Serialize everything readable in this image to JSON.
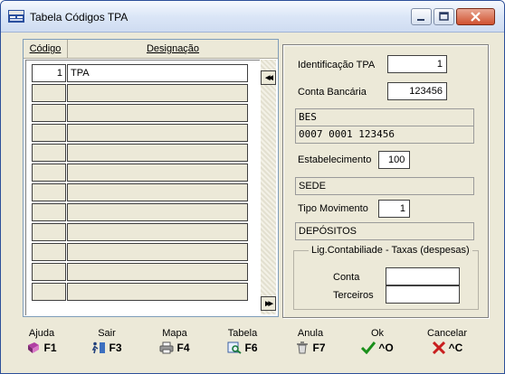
{
  "window": {
    "title": "Tabela Códigos TPA"
  },
  "grid": {
    "col_codigo": "Código",
    "col_designacao": "Designação",
    "rows": [
      {
        "codigo": "1",
        "designacao": "TPA"
      },
      {
        "codigo": "",
        "designacao": ""
      },
      {
        "codigo": "",
        "designacao": ""
      },
      {
        "codigo": "",
        "designacao": ""
      },
      {
        "codigo": "",
        "designacao": ""
      },
      {
        "codigo": "",
        "designacao": ""
      },
      {
        "codigo": "",
        "designacao": ""
      },
      {
        "codigo": "",
        "designacao": ""
      },
      {
        "codigo": "",
        "designacao": ""
      },
      {
        "codigo": "",
        "designacao": ""
      },
      {
        "codigo": "",
        "designacao": ""
      },
      {
        "codigo": "",
        "designacao": ""
      }
    ],
    "scroll_up_glyph": "◀◀",
    "scroll_down_glyph": "▶▶"
  },
  "form": {
    "identificacao_label": "Identificação TPA",
    "identificacao_value": "1",
    "conta_label": "Conta Bancária",
    "conta_value": "123456",
    "banco_nome": "BES",
    "banco_nib": "0007 0001 123456",
    "estabelecimento_label": "Estabelecimento",
    "estabelecimento_value": "100",
    "estabelecimento_nome": "SEDE",
    "tipo_mov_label": "Tipo Movimento",
    "tipo_mov_value": "1",
    "tipo_mov_nome": "DEPÓSITOS",
    "lig_group_title": "Lig.Contabiliade - Taxas (despesas)",
    "conta_taxa_label": "Conta",
    "conta_taxa_value": "",
    "terceiros_label": "Terceiros",
    "terceiros_value": ""
  },
  "footer": {
    "ajuda": {
      "label": "Ajuda",
      "key": "F1",
      "icon": "book-icon"
    },
    "sair": {
      "label": "Sair",
      "key": "F3",
      "icon": "exit-icon"
    },
    "mapa": {
      "label": "Mapa",
      "key": "F4",
      "icon": "printer-icon"
    },
    "tabela": {
      "label": "Tabela",
      "key": "F6",
      "icon": "table-search-icon"
    },
    "anula": {
      "label": "Anula",
      "key": "F7",
      "icon": "trash-icon"
    },
    "ok": {
      "label": "Ok",
      "key": "^O",
      "icon": "check-icon"
    },
    "cancelar": {
      "label": "Cancelar",
      "key": "^C",
      "icon": "x-icon"
    }
  },
  "colors": {
    "window_bg": "#ece9d8",
    "accent_ok": "#1a8f1a",
    "accent_cancel": "#c81e1e"
  }
}
